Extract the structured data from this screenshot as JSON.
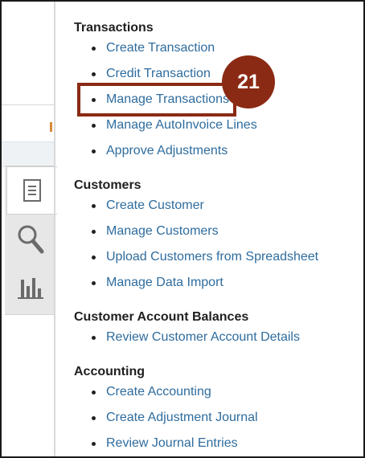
{
  "sections": [
    {
      "title": "Transactions",
      "items": [
        {
          "label": "Create Transaction"
        },
        {
          "label": "Credit Transaction"
        },
        {
          "label": "Manage Transactions"
        },
        {
          "label": "Manage AutoInvoice Lines"
        },
        {
          "label": "Approve Adjustments"
        }
      ]
    },
    {
      "title": "Customers",
      "items": [
        {
          "label": "Create Customer"
        },
        {
          "label": "Manage Customers"
        },
        {
          "label": "Upload Customers from Spreadsheet"
        },
        {
          "label": "Manage Data Import"
        }
      ]
    },
    {
      "title": "Customer Account Balances",
      "items": [
        {
          "label": "Review Customer Account Details"
        }
      ]
    },
    {
      "title": "Accounting",
      "items": [
        {
          "label": "Create Accounting"
        },
        {
          "label": "Create Adjustment Journal"
        },
        {
          "label": "Review Journal Entries"
        }
      ]
    }
  ],
  "callout": {
    "step_number": "21",
    "highlighted_item": "Manage Transactions",
    "color": "#8b2a14"
  },
  "rail": {
    "tabs": [
      {
        "icon": "document-icon",
        "active": true
      },
      {
        "icon": "search-icon",
        "active": false
      },
      {
        "icon": "bar-chart-icon",
        "active": false
      }
    ]
  },
  "colors": {
    "link": "#2e6c9e",
    "heading": "#1f1f1f"
  }
}
